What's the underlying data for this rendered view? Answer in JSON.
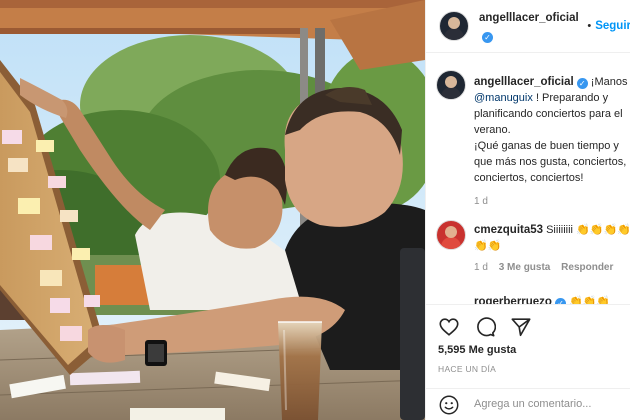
{
  "post": {
    "username": "angelllacer_oficial",
    "follow_label": "Seguir",
    "caption_lines": [
      "¡Manos",
      "! Preparando y",
      "planificando conciertos para el",
      "verano.",
      "¡Qué ganas de buen tiempo y",
      "que más nos gusta, conciertos,",
      "conciertos, conciertos!"
    ],
    "mention": "@manuguix",
    "caption_age": "1 d",
    "likes": "5,595 Me gusta",
    "time_ago": "HACE UN DÍA",
    "add_comment_placeholder": "Agrega un comentario..."
  },
  "comments": [
    {
      "username": "cmezquita53",
      "text": "Siiiiiiii",
      "emoji": "👏👏👏👏👏👏👏👏👏",
      "age": "1 d",
      "likes": "3 Me gusta",
      "reply_label": "Responder"
    },
    {
      "username": "rogerberruezo",
      "emoji": "👏👏👏"
    }
  ],
  "icons": {
    "like": "heart-icon",
    "comment": "comment-icon",
    "share": "share-icon",
    "more": "more-icon",
    "emoji": "emoji-icon",
    "verified": "verified-icon"
  },
  "colors": {
    "link_blue": "#0095f6",
    "mention_blue": "#00376b",
    "verified_blue": "#3897f0",
    "muted_gray": "#8e8e8e"
  }
}
